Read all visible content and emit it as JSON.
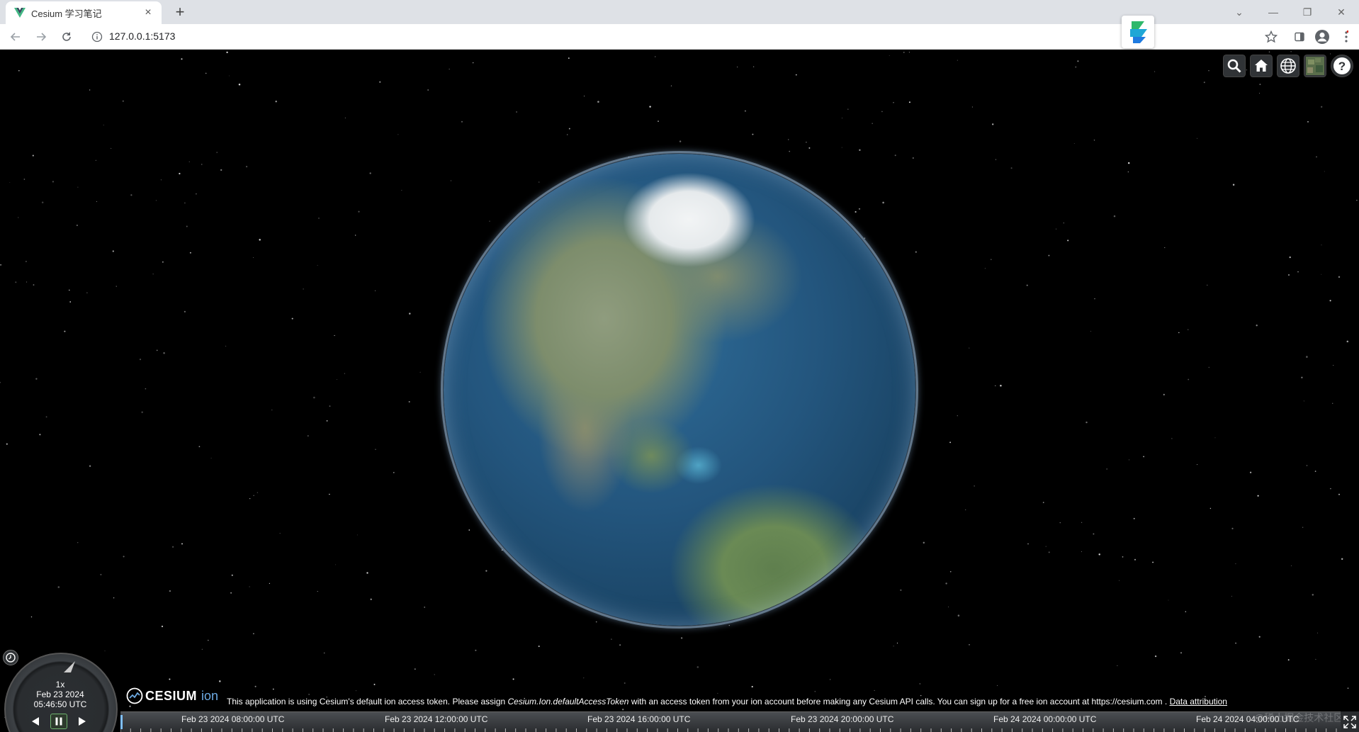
{
  "browser": {
    "tab_title": "Cesium 学习笔记",
    "tab_close": "×",
    "new_tab": "+",
    "address": "127.0.0.1:5173",
    "win_minimize": "—",
    "win_restore": "❐",
    "win_close": "✕",
    "win_dropdown": "⌄"
  },
  "toolbar_buttons": [
    "search-icon",
    "home-icon",
    "globe-icon",
    "imagery-icon",
    "help-icon"
  ],
  "animation": {
    "speed": "1x",
    "date": "Feb 23 2024",
    "time": "05:46:50 UTC"
  },
  "credits": {
    "logo_text": "CESIUM",
    "logo_suffix": "ion",
    "message_pre": "This application is using Cesium's default ion access token. Please assign ",
    "message_em": "Cesium.Ion.defaultAccessToken",
    "message_post": " with an access token from your ion account before making any Cesium API calls. You can sign up for a free ion account at ",
    "url": "https://cesium.com",
    "separator": ".",
    "data_attribution": "Data attribution"
  },
  "timeline": {
    "labels": [
      "Feb 23 2024 08:00:00 UTC",
      "Feb 23 2024 12:00:00 UTC",
      "Feb 23 2024 16:00:00 UTC",
      "Feb 23 2024 20:00:00 UTC",
      "Feb 24 2024 00:00:00 UTC",
      "Feb 24 2024 04:00:00 UTC"
    ]
  },
  "watermark": "@稀土掘金技术社区",
  "colors": {
    "accent_green": "#6fb36f",
    "cesium_blue": "#6dabe4"
  }
}
